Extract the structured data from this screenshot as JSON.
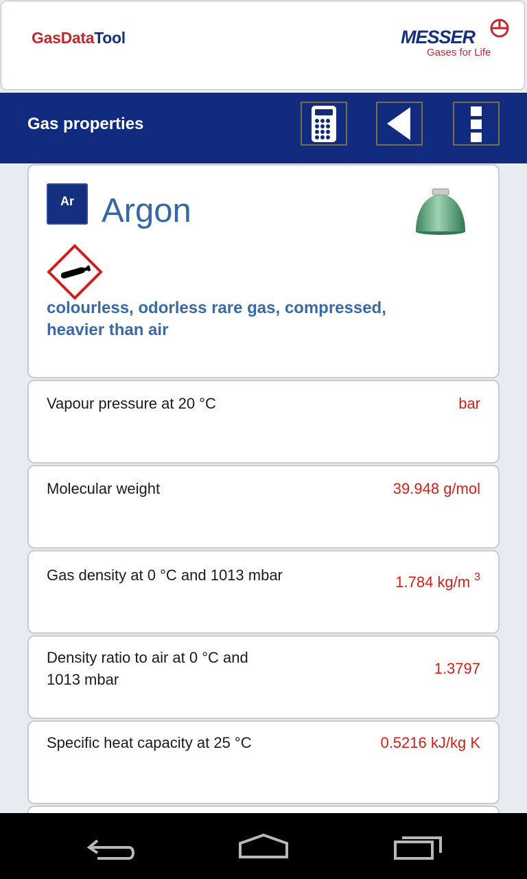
{
  "header": {
    "app_name_part1": "GasData",
    "app_name_part2": "Tool",
    "brand": "MESSER",
    "tagline": "Gases for Life"
  },
  "toolbar": {
    "title": "Gas properties",
    "buttons": [
      "calculator-icon",
      "back-triangle-icon",
      "overflow-menu-icon"
    ]
  },
  "gas": {
    "symbol": "Ar",
    "name": "Argon",
    "description_line1": "colourless, odorless rare gas, compressed,",
    "description_line2": "heavier than air",
    "cylinder_color": "#4f9a6e",
    "hazard_pictogram": "gas-cylinder-hazard-icon"
  },
  "properties": [
    {
      "label": "Vapour pressure at 20 °C",
      "value": "bar"
    },
    {
      "label": "Molecular weight",
      "value": "39.948 g/mol"
    },
    {
      "label": "Gas density at 0 °C and 1013 mbar",
      "value": "1.784 kg/m",
      "value_sup": "3"
    },
    {
      "label": "Density ratio to air at 0 °C and 1013 mbar",
      "value": "1.3797"
    },
    {
      "label": "Specific heat capacity at 25 °C",
      "value": "0.5216 kJ/kg K"
    }
  ],
  "colors": {
    "primary_blue": "#112c7e",
    "accent_red": "#d0201a",
    "description_blue": "#3a6aa5"
  },
  "navbar": {
    "buttons": [
      "nav-back-icon",
      "nav-home-icon",
      "nav-recents-icon"
    ]
  }
}
